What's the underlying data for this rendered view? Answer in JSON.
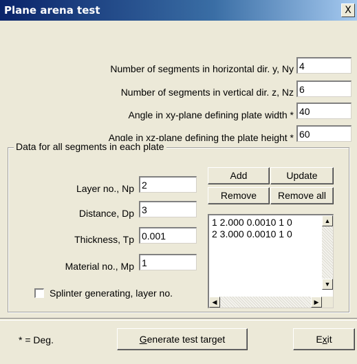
{
  "window": {
    "title": "Plane arena test",
    "close_glyph": "X"
  },
  "top_fields": [
    {
      "label": "Number of segments in horizontal dir. y, Ny",
      "value": "4"
    },
    {
      "label": "Number of segments in vertical dir. z, Nz",
      "value": "6"
    },
    {
      "label": "Angle in xy-plane defining plate width *",
      "value": "40"
    },
    {
      "label": "Angle in xz-plane defining the plate height *",
      "value": "60"
    }
  ],
  "group": {
    "title": "Data for all segments in each plate",
    "fields": [
      {
        "label": "Layer no., Np",
        "value": "2"
      },
      {
        "label": "Distance, Dp",
        "value": "3"
      },
      {
        "label": "Thickness, Tp",
        "value": "0.001"
      },
      {
        "label": "Material no., Mp",
        "value": "1"
      }
    ],
    "checkbox_label": "Splinter generating, layer no.",
    "checkbox_checked": false,
    "buttons": {
      "add": "Add",
      "update": "Update",
      "remove": "Remove",
      "remove_all": "Remove all"
    },
    "list_items": [
      "1 2.000 0.0010 1 0",
      "2 3.000 0.0010 1 0"
    ]
  },
  "footer": {
    "note": "* = Deg.",
    "generate_mnemonic": "G",
    "generate_rest": "enerate test target",
    "exit_pre": "E",
    "exit_mnemonic": "x",
    "exit_post": "it"
  }
}
